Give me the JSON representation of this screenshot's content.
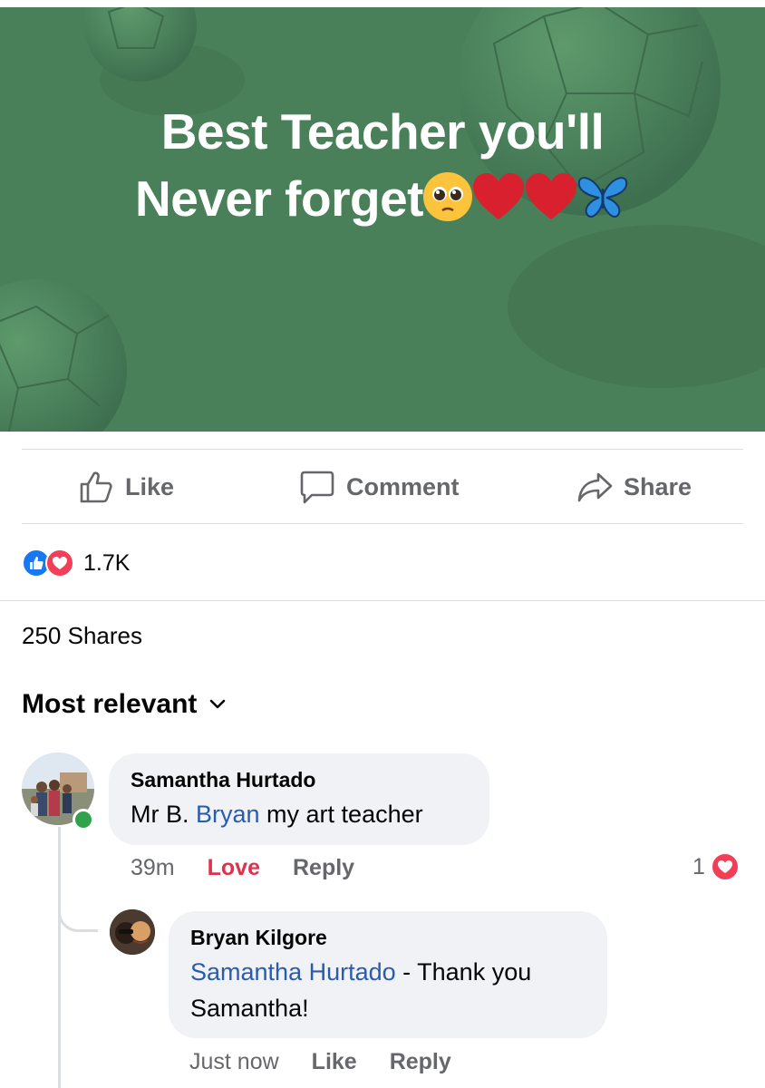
{
  "post": {
    "title_line1": "Best Teacher you'll",
    "title_line2": "Never forget",
    "title_emojis": [
      "pleading-face-emoji",
      "red-heart-emoji",
      "red-heart-emoji",
      "blue-butterfly-emoji"
    ],
    "background_color": "#4a8059"
  },
  "actions": {
    "like_label": "Like",
    "comment_label": "Comment",
    "share_label": "Share"
  },
  "reactions": {
    "icons": [
      "like-icon",
      "love-icon"
    ],
    "count": "1.7K"
  },
  "shares": {
    "text": "250 Shares"
  },
  "sort": {
    "label": "Most relevant"
  },
  "comments": [
    {
      "author": "Samantha Hurtado",
      "text_prefix": "Mr B. ",
      "mention": "Bryan",
      "text_suffix": " my art teacher",
      "time": "39m",
      "reaction_label": "Love",
      "reply_label": "Reply",
      "reaction_count": "1",
      "online": true
    }
  ],
  "replies": [
    {
      "author": "Bryan Kilgore",
      "mention": "Samantha Hurtado",
      "text_suffix": " - Thank you",
      "text_line2": "Samantha!",
      "time": "Just now",
      "like_label": "Like",
      "reply_label": "Reply"
    }
  ],
  "colors": {
    "accent_blue": "#1877f2",
    "love_red": "#e0314d",
    "mention_blue": "#2a5cad",
    "online_green": "#31a24c",
    "muted_text": "#65676b"
  }
}
